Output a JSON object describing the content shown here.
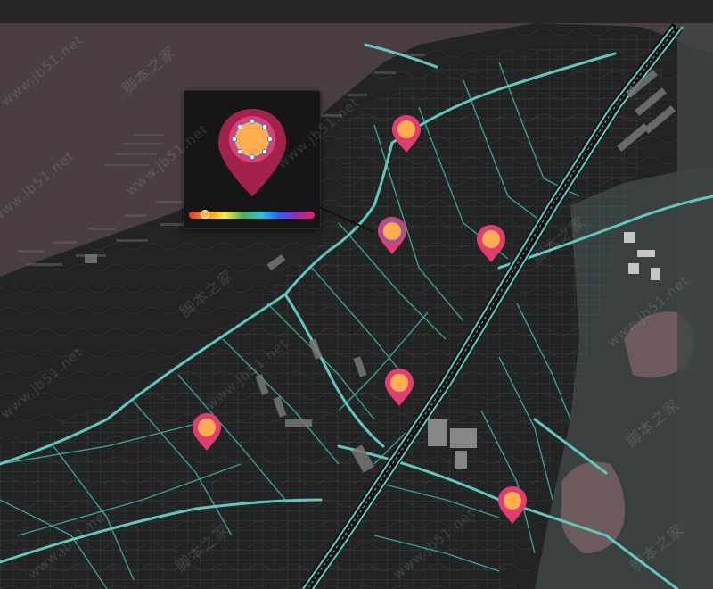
{
  "map": {
    "background_color": "#232323",
    "land_tint_color": "#4a3e40",
    "road_color": "#5fc7c0",
    "marker_outer_color": "#e23d73",
    "marker_inner_color": "#ffad4f",
    "markers": [
      {
        "id": "marker-1"
      },
      {
        "id": "marker-2"
      },
      {
        "id": "marker-3"
      },
      {
        "id": "marker-4"
      },
      {
        "id": "marker-5"
      },
      {
        "id": "marker-6"
      }
    ]
  },
  "marker_editor": {
    "slider_value": 0.1,
    "icon": "map-pin-icon"
  },
  "watermarks": {
    "domain": "www.jb51.net",
    "site_name": "脚本之家"
  }
}
